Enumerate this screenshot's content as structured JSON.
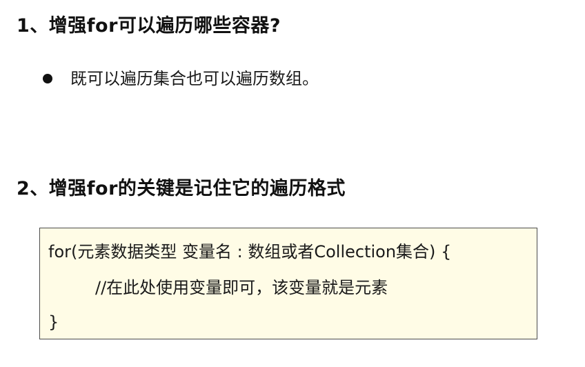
{
  "sections": [
    {
      "heading": "1、增强for可以遍历哪些容器?",
      "bullets": [
        "既可以遍历集合也可以遍历数组。"
      ]
    },
    {
      "heading": "2、增强for的关键是记住它的遍历格式",
      "code": {
        "line1": "for(元素数据类型 变量名 : 数组或者Collection集合) {",
        "line2": "//在此处使用变量即可，该变量就是元素",
        "line3": "}"
      }
    }
  ],
  "colors": {
    "text": "#111111",
    "code_background": "#fffce6",
    "code_border": "#4a4a4a"
  }
}
